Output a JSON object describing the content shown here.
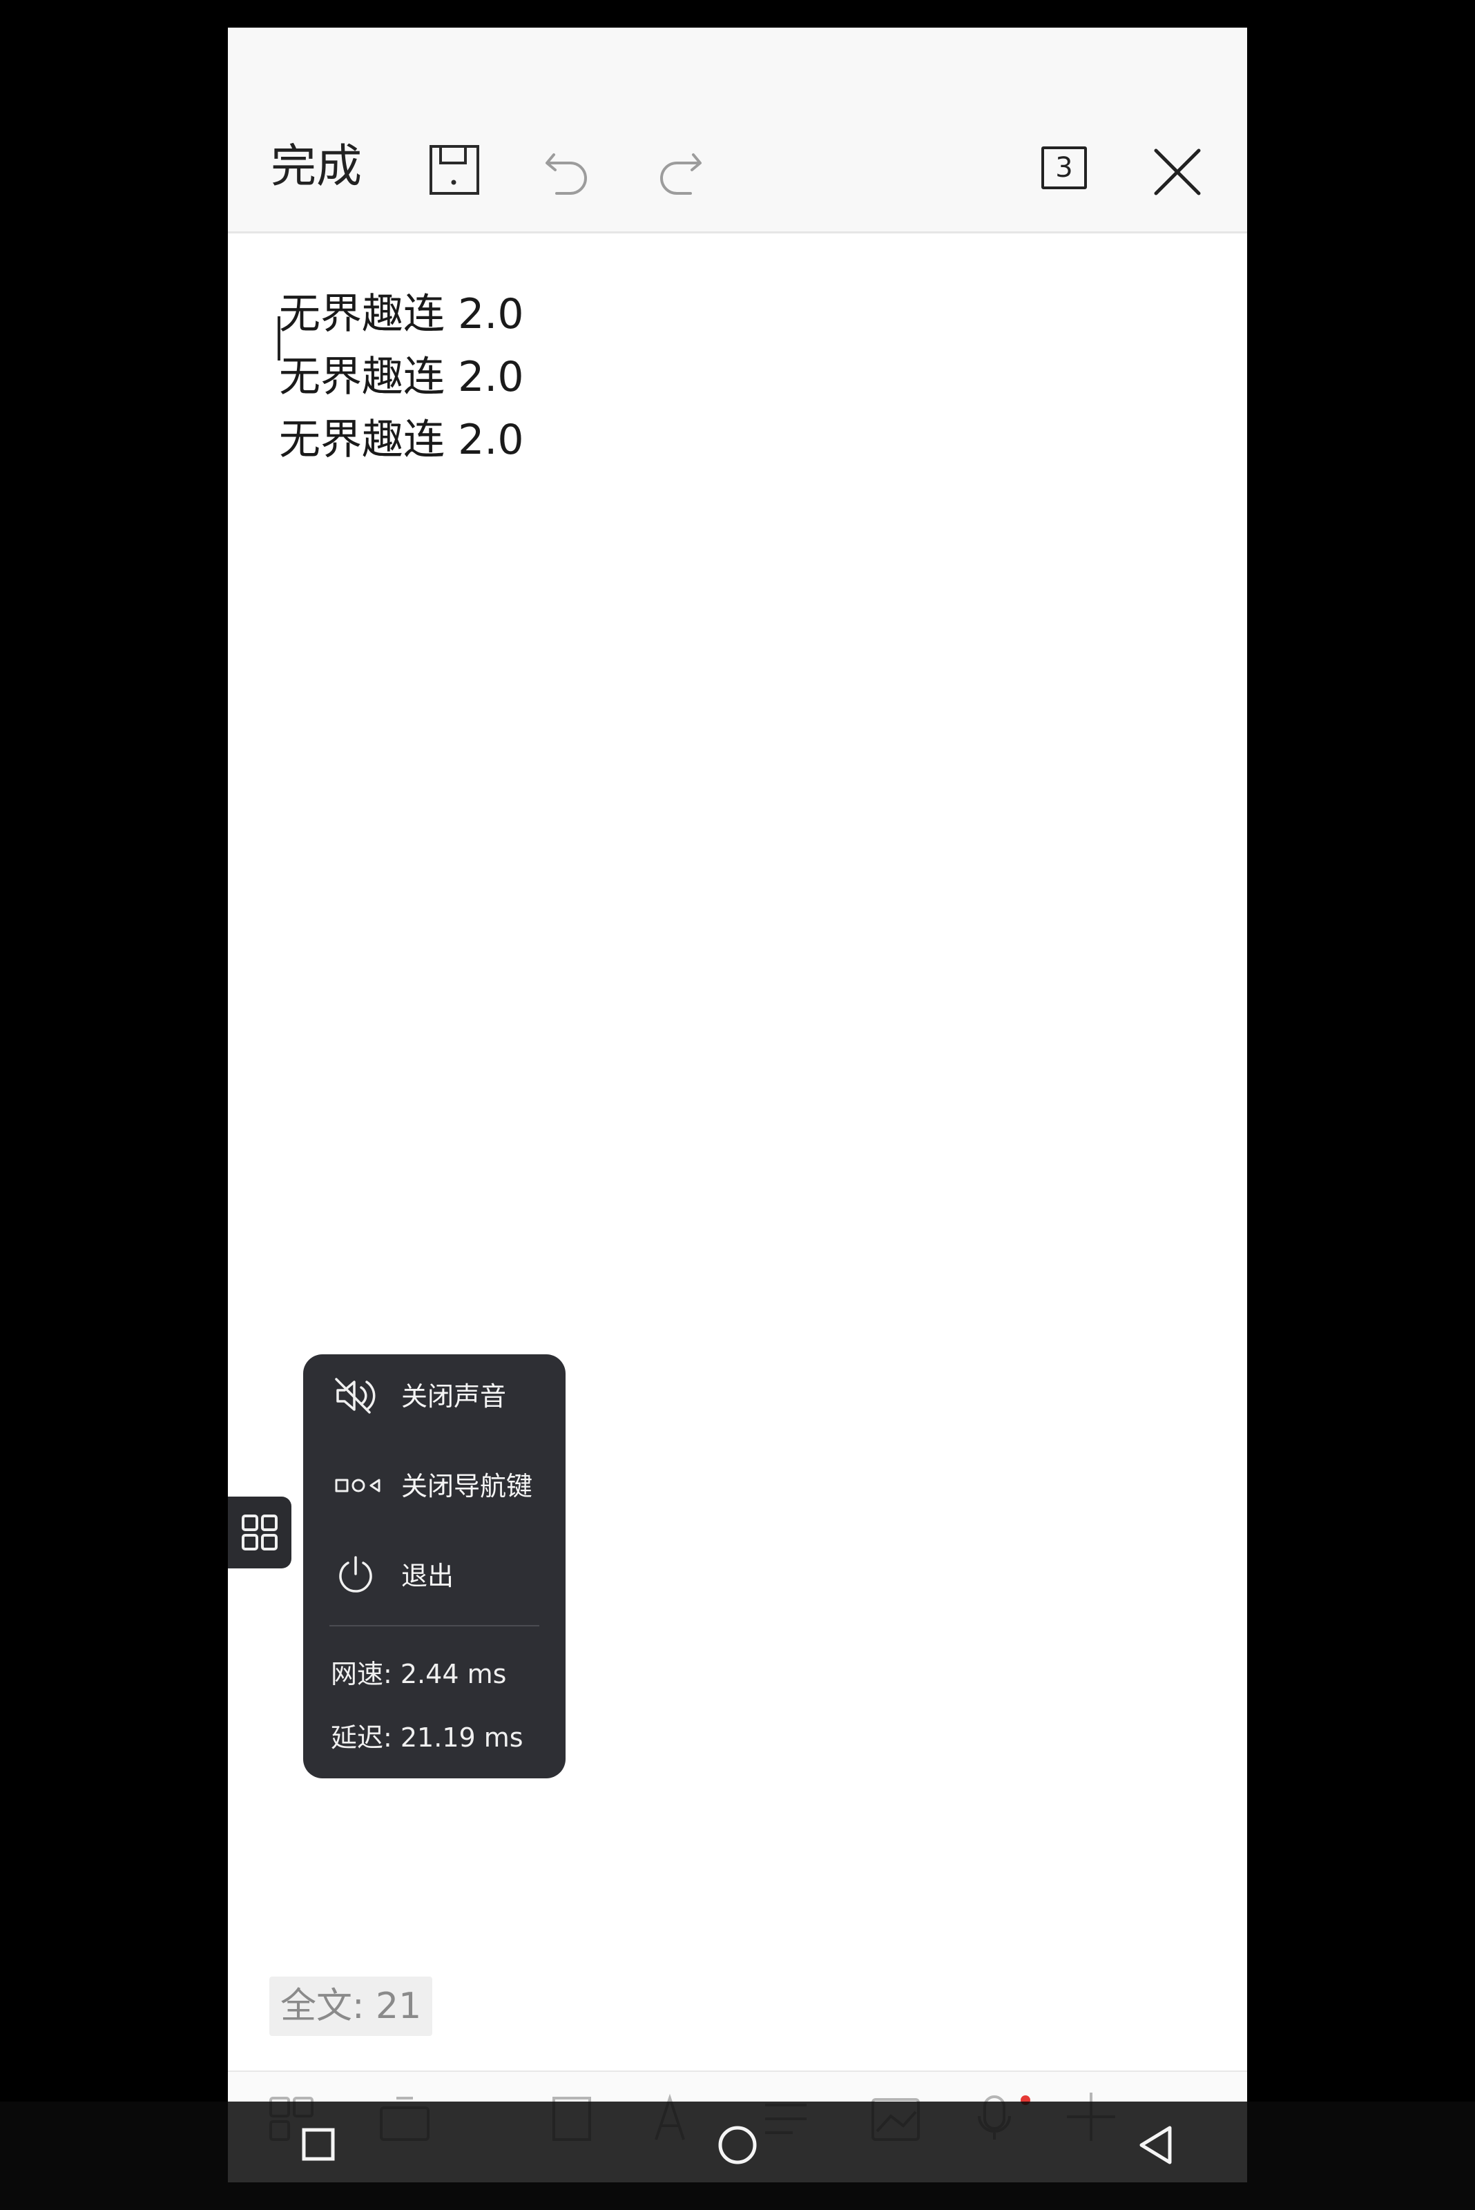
{
  "toolbar": {
    "done_label": "完成",
    "save_icon": "save-icon",
    "undo_icon": "undo-icon",
    "redo_icon": "redo-icon",
    "page_count": "3",
    "close_icon": "close-icon"
  },
  "editor": {
    "lines": [
      "无界趣连 2.0",
      "无界趣连 2.0",
      "无界趣连 2.0"
    ]
  },
  "footer": {
    "word_count": "全文: 21"
  },
  "popup_menu": {
    "items": [
      {
        "icon": "mute-icon",
        "label": "关闭声音"
      },
      {
        "icon": "nav-keys-icon",
        "label": "关闭导航键"
      },
      {
        "icon": "power-icon",
        "label": "退出"
      }
    ],
    "net_speed": "网速: 2.44 ms",
    "latency": "延迟: 21.19 ms"
  },
  "colors": {
    "popup_bg": "#2e2f34",
    "toolbar_bg": "#f8f8f8",
    "accent_dot": "#e53935"
  }
}
